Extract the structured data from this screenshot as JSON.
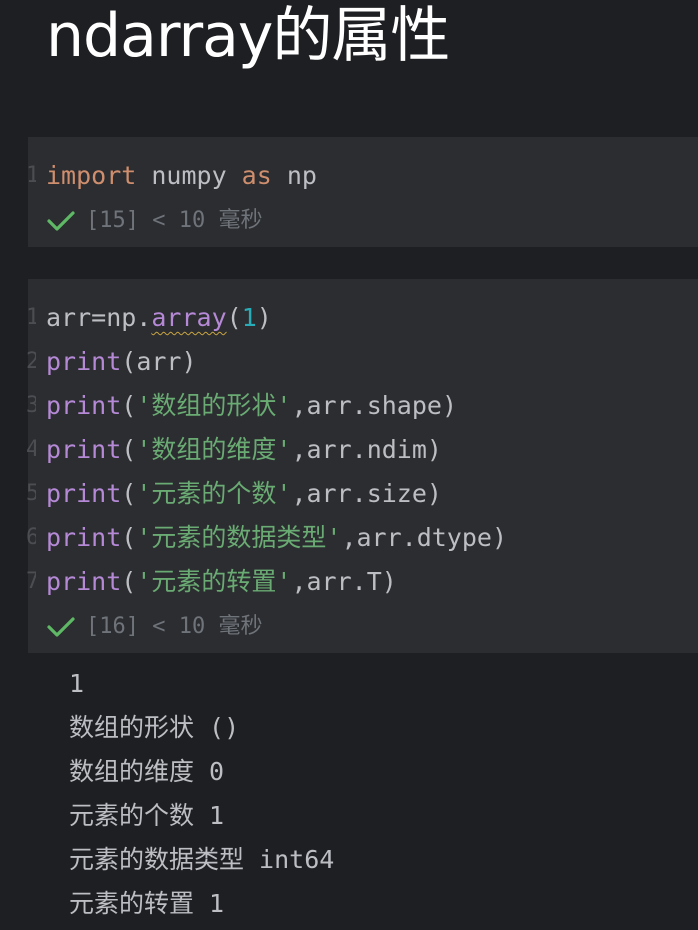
{
  "page": {
    "title": "ndarray的属性"
  },
  "cells": [
    {
      "gutter": [
        "1"
      ],
      "code": {
        "kw1": "import",
        "mod": " numpy ",
        "kw2": "as",
        "alias": " np"
      },
      "status": {
        "icon": "check-icon",
        "counter": "[15]",
        "time": "< 10 毫秒"
      }
    },
    {
      "gutter": [
        "1",
        "2",
        "3",
        "4",
        "5",
        "6",
        "7"
      ],
      "lines": [
        {
          "a": "arr=np.",
          "b": "array",
          "c": "(",
          "d": "1",
          "e": ")"
        },
        {
          "fn": "print",
          "rest": "(arr)"
        },
        {
          "fn": "print",
          "p": "(",
          "s": "'数组的形状'",
          "rest": ",arr.shape)"
        },
        {
          "fn": "print",
          "p": "(",
          "s": "'数组的维度'",
          "rest": ",arr.ndim)"
        },
        {
          "fn": "print",
          "p": "(",
          "s": "'元素的个数'",
          "rest": ",arr.size)"
        },
        {
          "fn": "print",
          "p": "(",
          "s": "'元素的数据类型'",
          "rest": ",arr.dtype)"
        },
        {
          "fn": "print",
          "p": "(",
          "s": "'元素的转置'",
          "rest": ",arr.T)"
        }
      ],
      "status": {
        "icon": "check-icon",
        "counter": "[16]",
        "time": "< 10 毫秒"
      }
    }
  ],
  "output": [
    "1",
    "数组的形状 ()",
    "数组的维度 0",
    "元素的个数 1",
    "元素的数据类型 int64",
    "元素的转置 1"
  ],
  "colors": {
    "background": "#1e1f22",
    "cell": "#2b2d30",
    "keyword": "#cf8e6d",
    "function": "#b589d6",
    "string": "#6aab73",
    "number": "#2aacb8",
    "success": "#5fb865"
  }
}
